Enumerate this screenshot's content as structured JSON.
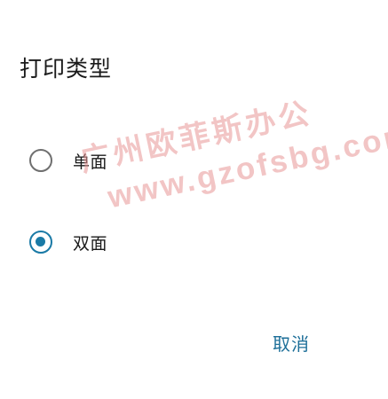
{
  "dialog": {
    "title": "打印类型",
    "options": [
      {
        "label": "单面",
        "selected": false
      },
      {
        "label": "双面",
        "selected": true
      }
    ],
    "cancel_label": "取消"
  },
  "watermark": {
    "line1": "广州欧菲斯办公",
    "line2": "www.gzofsbg.com"
  },
  "colors": {
    "accent": "#1a7aa6",
    "cancel_text": "#1d6f99",
    "radio_unchecked": "#6f6f6f",
    "watermark": "#e89696"
  }
}
